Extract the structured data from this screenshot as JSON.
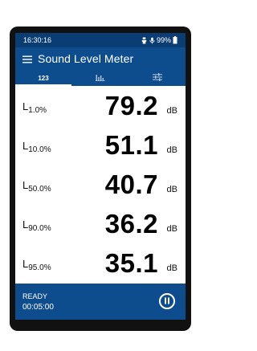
{
  "status_bar": {
    "time": "16:30:16",
    "battery": "99%",
    "icons": [
      "usb-debug-icon",
      "microphone-icon",
      "battery-icon"
    ]
  },
  "app_bar": {
    "title": "Sound Level Meter",
    "menu_icon": "hamburger-menu-icon"
  },
  "tabs": [
    {
      "label": "123",
      "selected": true
    },
    {
      "icon": "bar-chart-icon",
      "selected": false
    },
    {
      "icon": "settings-sliders-icon",
      "selected": false
    }
  ],
  "rows": [
    {
      "label": "L",
      "sub": "1.0%",
      "value": "79.2",
      "unit": "dB"
    },
    {
      "label": "L",
      "sub": "10.0%",
      "value": "51.1",
      "unit": "dB"
    },
    {
      "label": "L",
      "sub": "50.0%",
      "value": "40.7",
      "unit": "dB"
    },
    {
      "label": "L",
      "sub": "90.0%",
      "value": "36.2",
      "unit": "dB"
    },
    {
      "label": "L",
      "sub": "95.0%",
      "value": "35.1",
      "unit": "dB"
    }
  ],
  "bottom_bar": {
    "state": "READY",
    "elapsed": "00:05:00",
    "pause_icon": "pause-icon"
  },
  "colors": {
    "primary": "#0e4d8d",
    "status_bar": "#0a3d73",
    "text_on_primary": "#ffffff"
  }
}
